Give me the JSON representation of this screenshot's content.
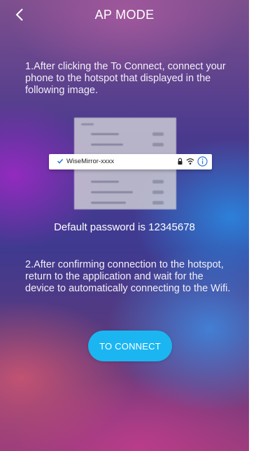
{
  "header": {
    "title": "AP MODE",
    "back_icon": "chevron-left-icon"
  },
  "instructions": {
    "step1": "1.After clicking the To Connect, connect your phone to the hotspot that displayed in the following image.",
    "step2": "2.After confirming connection to the hotspot, return to the application and wait for the device to automatically connecting to the Wifi."
  },
  "hotspot_image": {
    "network_name": "WiseMirror-xxxx",
    "icons": [
      "check-icon",
      "lock-icon",
      "wifi-icon",
      "info-icon"
    ]
  },
  "password": {
    "text": "Default password is 12345678"
  },
  "actions": {
    "connect_label": "TO CONNECT"
  },
  "colors": {
    "accent_button": "#1bb6f2",
    "check_color": "#2f7bd6",
    "info_color": "#2f7bd6"
  }
}
